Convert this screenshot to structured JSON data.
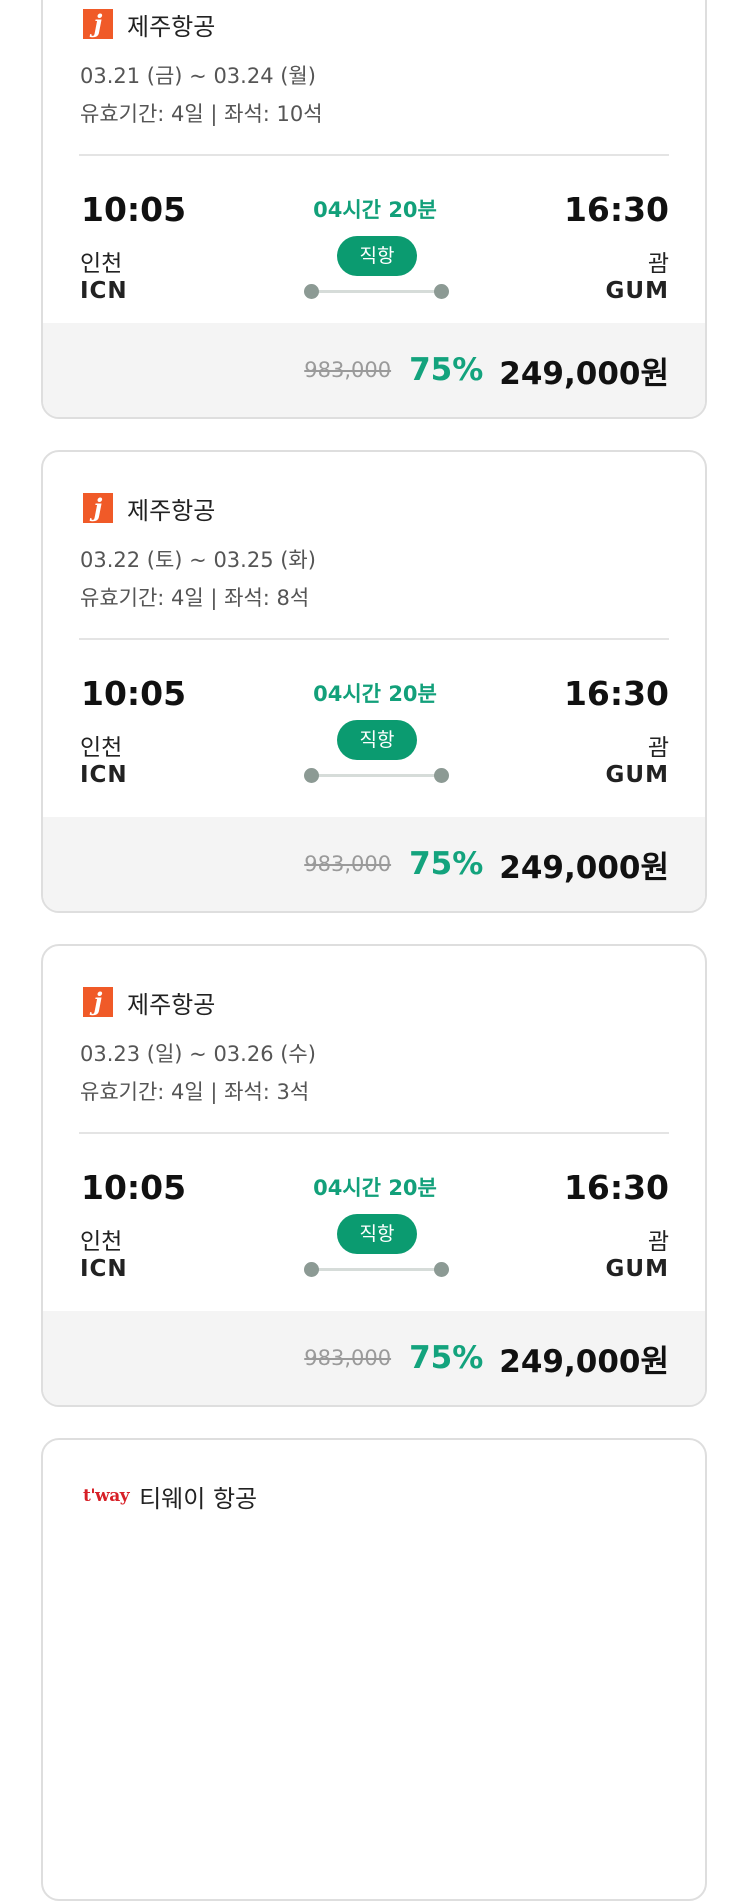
{
  "cards": [
    {
      "airline": "제주항공",
      "logo": "jeju-air-logo",
      "logo_text": "j",
      "dates": "03.21 (금) ~ 03.24 (월)",
      "validity": "유효기간: 4일 | 좌석: 10석",
      "dep_time": "10:05",
      "dep_city": "인천",
      "dep_code": "ICN",
      "duration": "04시간 20분",
      "direct": "직항",
      "arr_time": "16:30",
      "arr_city": "괌",
      "arr_code": "GUM",
      "original_price": "983,000",
      "discount": "75%",
      "final_price": "249,000원"
    },
    {
      "airline": "제주항공",
      "logo": "jeju-air-logo",
      "logo_text": "j",
      "dates": "03.22 (토) ~ 03.25 (화)",
      "validity": "유효기간: 4일 | 좌석: 8석",
      "dep_time": "10:05",
      "dep_city": "인천",
      "dep_code": "ICN",
      "duration": "04시간 20분",
      "direct": "직항",
      "arr_time": "16:30",
      "arr_city": "괌",
      "arr_code": "GUM",
      "original_price": "983,000",
      "discount": "75%",
      "final_price": "249,000원"
    },
    {
      "airline": "제주항공",
      "logo": "jeju-air-logo",
      "logo_text": "j",
      "dates": "03.23 (일) ~ 03.26 (수)",
      "validity": "유효기간: 4일 | 좌석: 3석",
      "dep_time": "10:05",
      "dep_city": "인천",
      "dep_code": "ICN",
      "duration": "04시간 20분",
      "direct": "직항",
      "arr_time": "16:30",
      "arr_city": "괌",
      "arr_code": "GUM",
      "original_price": "983,000",
      "discount": "75%",
      "final_price": "249,000원"
    },
    {
      "airline": "티웨이 항공",
      "logo": "tway-air-logo",
      "logo_text": "t'way"
    }
  ],
  "colors": {
    "accent_green": "#12a07a",
    "badge_green": "#0b9b70",
    "jeju_orange": "#f05a28",
    "tway_red": "#d71f26"
  }
}
